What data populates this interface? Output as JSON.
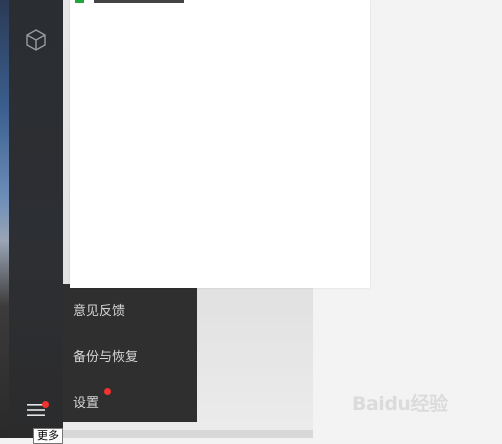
{
  "sidebar": {
    "mini_icon": "cube-icon",
    "menu_icon": "hamburger-menu-icon",
    "menu_tooltip": "更多"
  },
  "context_menu": {
    "items": [
      {
        "label": "意见反馈",
        "badge": false
      },
      {
        "label": "备份与恢复",
        "badge": false
      },
      {
        "label": "设置",
        "badge": true
      }
    ]
  },
  "colors": {
    "badge_red": "#f0332e",
    "sidebar_bg": "#2d2f33",
    "menu_bg": "#2f2f2f",
    "accent_green": "#1fa83a"
  },
  "watermark": {
    "text": "Baidu经验",
    "icon": "baidu-paw-icon"
  }
}
